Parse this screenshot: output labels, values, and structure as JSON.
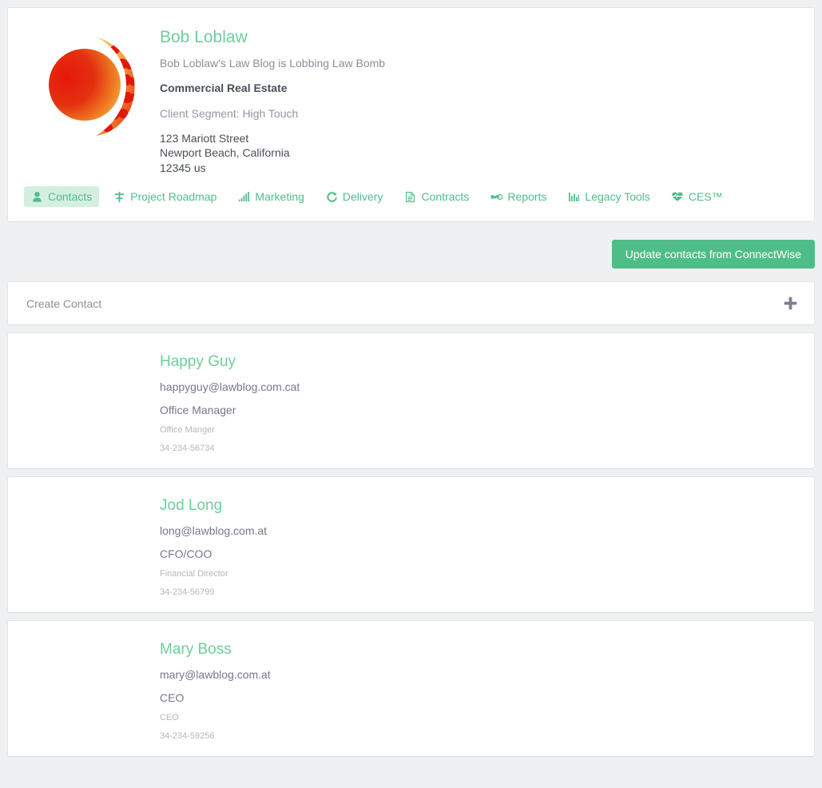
{
  "company": {
    "logo_icon": "company-sphere-logo",
    "name": "Bob Loblaw",
    "tagline": "Bob Loblaw's Law Blog is Lobbing Law Bomb",
    "industry": "Commercial Real Estate",
    "segment": "Client Segment: High Touch",
    "address_line1": "123 Mariott Street",
    "address_line2": "Newport Beach, California",
    "address_line3": "12345 us"
  },
  "tabs": [
    {
      "label": "Contacts",
      "icon": "user-icon",
      "active": true
    },
    {
      "label": "Project Roadmap",
      "icon": "sitemap-icon",
      "active": false
    },
    {
      "label": "Marketing",
      "icon": "signal-icon",
      "active": false
    },
    {
      "label": "Delivery",
      "icon": "refresh-icon",
      "active": false
    },
    {
      "label": "Contracts",
      "icon": "file-text-icon",
      "active": false
    },
    {
      "label": "Reports",
      "icon": "handshake-icon",
      "active": false
    },
    {
      "label": "Legacy Tools",
      "icon": "bar-chart-icon",
      "active": false
    },
    {
      "label": "CES™",
      "icon": "heartbeat-icon",
      "active": false
    }
  ],
  "actions": {
    "update_contacts_label": "Update contacts from ConnectWise"
  },
  "create_contact": {
    "label": "Create Contact",
    "icon": "plus-icon"
  },
  "contacts": [
    {
      "name": "Happy Guy",
      "email": "happyguy@lawblog.com.cat",
      "title": "Office Manager",
      "subtitle": "Office Manger",
      "phone": "34-234-56734"
    },
    {
      "name": "Jod Long",
      "email": "long@lawblog.com.at",
      "title": "CFO/COO",
      "subtitle": "Financial Director",
      "phone": "34-234-56799"
    },
    {
      "name": "Mary Boss",
      "email": "mary@lawblog.com.at",
      "title": "CEO",
      "subtitle": "CEO",
      "phone": "34-234-59256"
    }
  ],
  "colors": {
    "accent_green": "#4fbd87",
    "heading_green": "#6ece9c",
    "active_tab_bg": "#d4efe0",
    "page_bg": "#eff0f2",
    "card_bg": "#ffffff",
    "muted_text": "#b3b7bf",
    "logo_red": "#e01b0e",
    "logo_orange": "#f0872a"
  }
}
